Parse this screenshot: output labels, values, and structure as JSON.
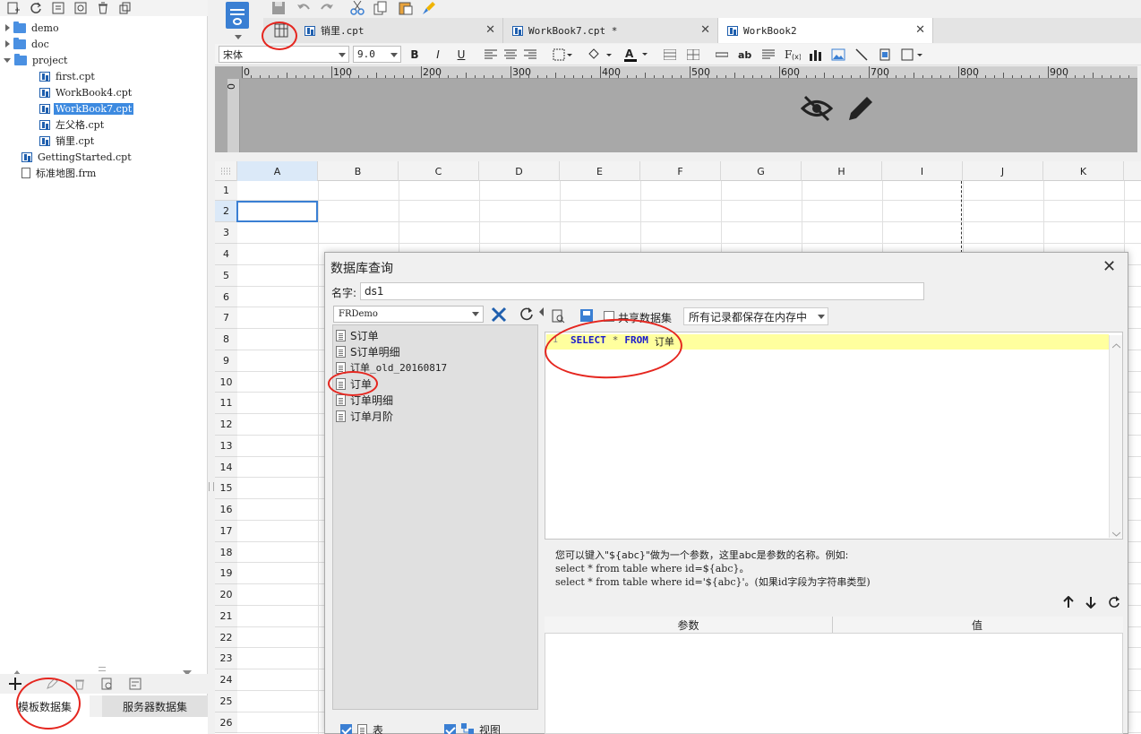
{
  "left_panel": {
    "tree": [
      {
        "label": "demo",
        "type": "folder",
        "expanded": false
      },
      {
        "label": "doc",
        "type": "folder",
        "expanded": false
      },
      {
        "label": "project",
        "type": "folder",
        "expanded": true
      },
      {
        "label": "first.cpt",
        "type": "cpt"
      },
      {
        "label": "WorkBook4.cpt",
        "type": "cpt"
      },
      {
        "label": "WorkBook7.cpt",
        "type": "cpt",
        "selected": true
      },
      {
        "label": "左父格.cpt",
        "type": "cpt"
      },
      {
        "label": "销里.cpt",
        "type": "cpt"
      },
      {
        "label": "GettingStarted.cpt",
        "type": "cpt"
      },
      {
        "label": "标准地图.frm",
        "type": "frm"
      }
    ],
    "dataset_tabs": [
      "模板数据集",
      "服务器数据集"
    ]
  },
  "editor_tabs": [
    {
      "label": "销里.cpt",
      "active": false
    },
    {
      "label": "WorkBook7.cpt *",
      "active": false
    },
    {
      "label": "WorkBook2",
      "active": true
    }
  ],
  "format_bar": {
    "font": "宋体",
    "size": "9.0",
    "bold": "B",
    "italic": "I",
    "underline": "U"
  },
  "ruler": {
    "labels": [
      "0",
      "100",
      "200",
      "300",
      "400",
      "500",
      "600",
      "700",
      "800",
      "900"
    ],
    "vertical": "0"
  },
  "sheet": {
    "columns": [
      "A",
      "B",
      "C",
      "D",
      "E",
      "F",
      "G",
      "H",
      "I",
      "J",
      "K"
    ],
    "rows": [
      "1",
      "2",
      "3",
      "4",
      "5",
      "6",
      "7",
      "8",
      "9",
      "10",
      "11",
      "12",
      "13",
      "14",
      "15",
      "16",
      "17",
      "18",
      "19",
      "20",
      "21",
      "22",
      "23",
      "24",
      "25",
      "26"
    ],
    "selected_cell": "A2"
  },
  "dialog": {
    "title": "数据库查询",
    "name_label": "名字:",
    "name_value": "ds1",
    "connection": "FRDemo",
    "tables": [
      "S订单",
      "S订单明细",
      "订单_old_20160817",
      "订单",
      "订单明细",
      "订单月阶"
    ],
    "share_dataset": "共享数据集",
    "memory_mode": "所有记录都保存在内存中",
    "sql": {
      "line_number": "1",
      "select": "SELECT",
      "star": "*",
      "from": "FROM",
      "table": "订单"
    },
    "help_lines": [
      "您可以键入\"${abc}\"做为一个参数，这里abc是参数的名称。例如:",
      "select * from table where id=${abc}。",
      "select * from table where id='${abc}'。(如果id字段为字符串类型)"
    ],
    "param_headers": [
      "参数",
      "值"
    ],
    "filter_table": "表",
    "filter_view": "视图"
  },
  "colors": {
    "accent": "#3a7fd3",
    "annotation": "#e5261f",
    "sql_highlight": "#ffff9e",
    "sql_keyword": "#1a1acc",
    "selection": "#3d8ae0"
  }
}
